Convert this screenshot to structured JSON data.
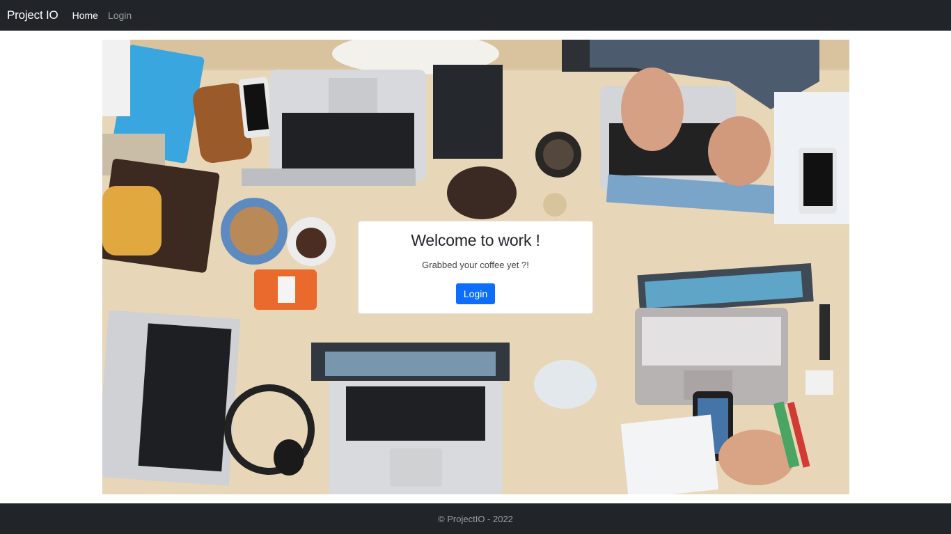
{
  "navbar": {
    "brand": "Project IO",
    "links": [
      {
        "label": "Home"
      },
      {
        "label": "Login"
      }
    ]
  },
  "hero": {
    "image_icon": "office-desk-photo"
  },
  "card": {
    "title": "Welcome to work !",
    "text": "Grabbed your coffee yet ?!",
    "button_label": "Login"
  },
  "footer": {
    "text": "© ProjectIO - 2022"
  },
  "colors": {
    "navbar_bg": "#212529",
    "primary": "#0d6efd",
    "table_wood": "#e6d2b3"
  }
}
